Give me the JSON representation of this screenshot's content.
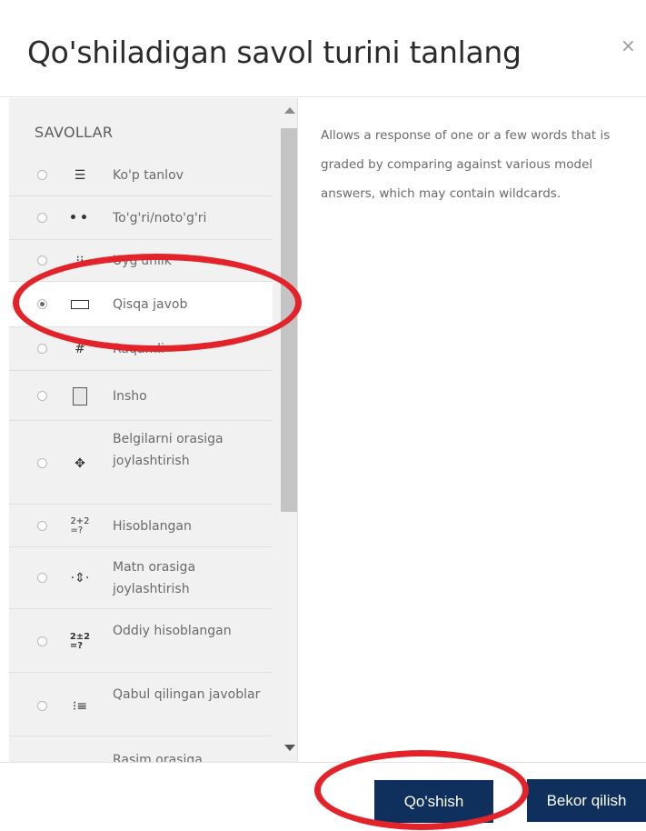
{
  "dialog": {
    "title": "Qo'shiladigan savol turini tanlang",
    "close_symbol": "×"
  },
  "options_section": {
    "label": "SAVOLLAR",
    "items": [
      {
        "label": "Ko'p tanlov",
        "icon": "multiple-choice-icon",
        "selected": false
      },
      {
        "label": "To'g'ri/noto'g'ri",
        "icon": "true-false-icon",
        "selected": false
      },
      {
        "label": "Uyg'unlik",
        "icon": "matching-icon",
        "selected": false
      },
      {
        "label": "Qisqa javob",
        "icon": "short-answer-icon",
        "selected": true
      },
      {
        "label": "Raqamli",
        "icon": "numerical-icon",
        "selected": false
      },
      {
        "label": "Insho",
        "icon": "essay-icon",
        "selected": false
      },
      {
        "label": "Belgilarni orasiga joylashtirish",
        "icon": "drag-drop-markers-icon",
        "selected": false
      },
      {
        "label": "Hisoblangan",
        "icon": "calculated-icon",
        "selected": false
      },
      {
        "label": "Matn orasiga joylashtirish",
        "icon": "drag-drop-text-icon",
        "selected": false
      },
      {
        "label": "Oddiy hisoblangan",
        "icon": "simple-calculated-icon",
        "selected": false
      },
      {
        "label": "Qabul qilingan javoblar",
        "icon": "embedded-answers-icon",
        "selected": false
      },
      {
        "label": "Rasim orasiga",
        "icon": "drag-drop-image-icon",
        "selected": false
      }
    ]
  },
  "description": "Allows a response of one or a few words that is graded by comparing against various model answers, which may contain wildcards.",
  "footer": {
    "add_label": "Qo'shish",
    "cancel_label": "Bekor qilish"
  },
  "colors": {
    "button_bg": "#0f2f5c",
    "annotation": "#e2232a"
  }
}
